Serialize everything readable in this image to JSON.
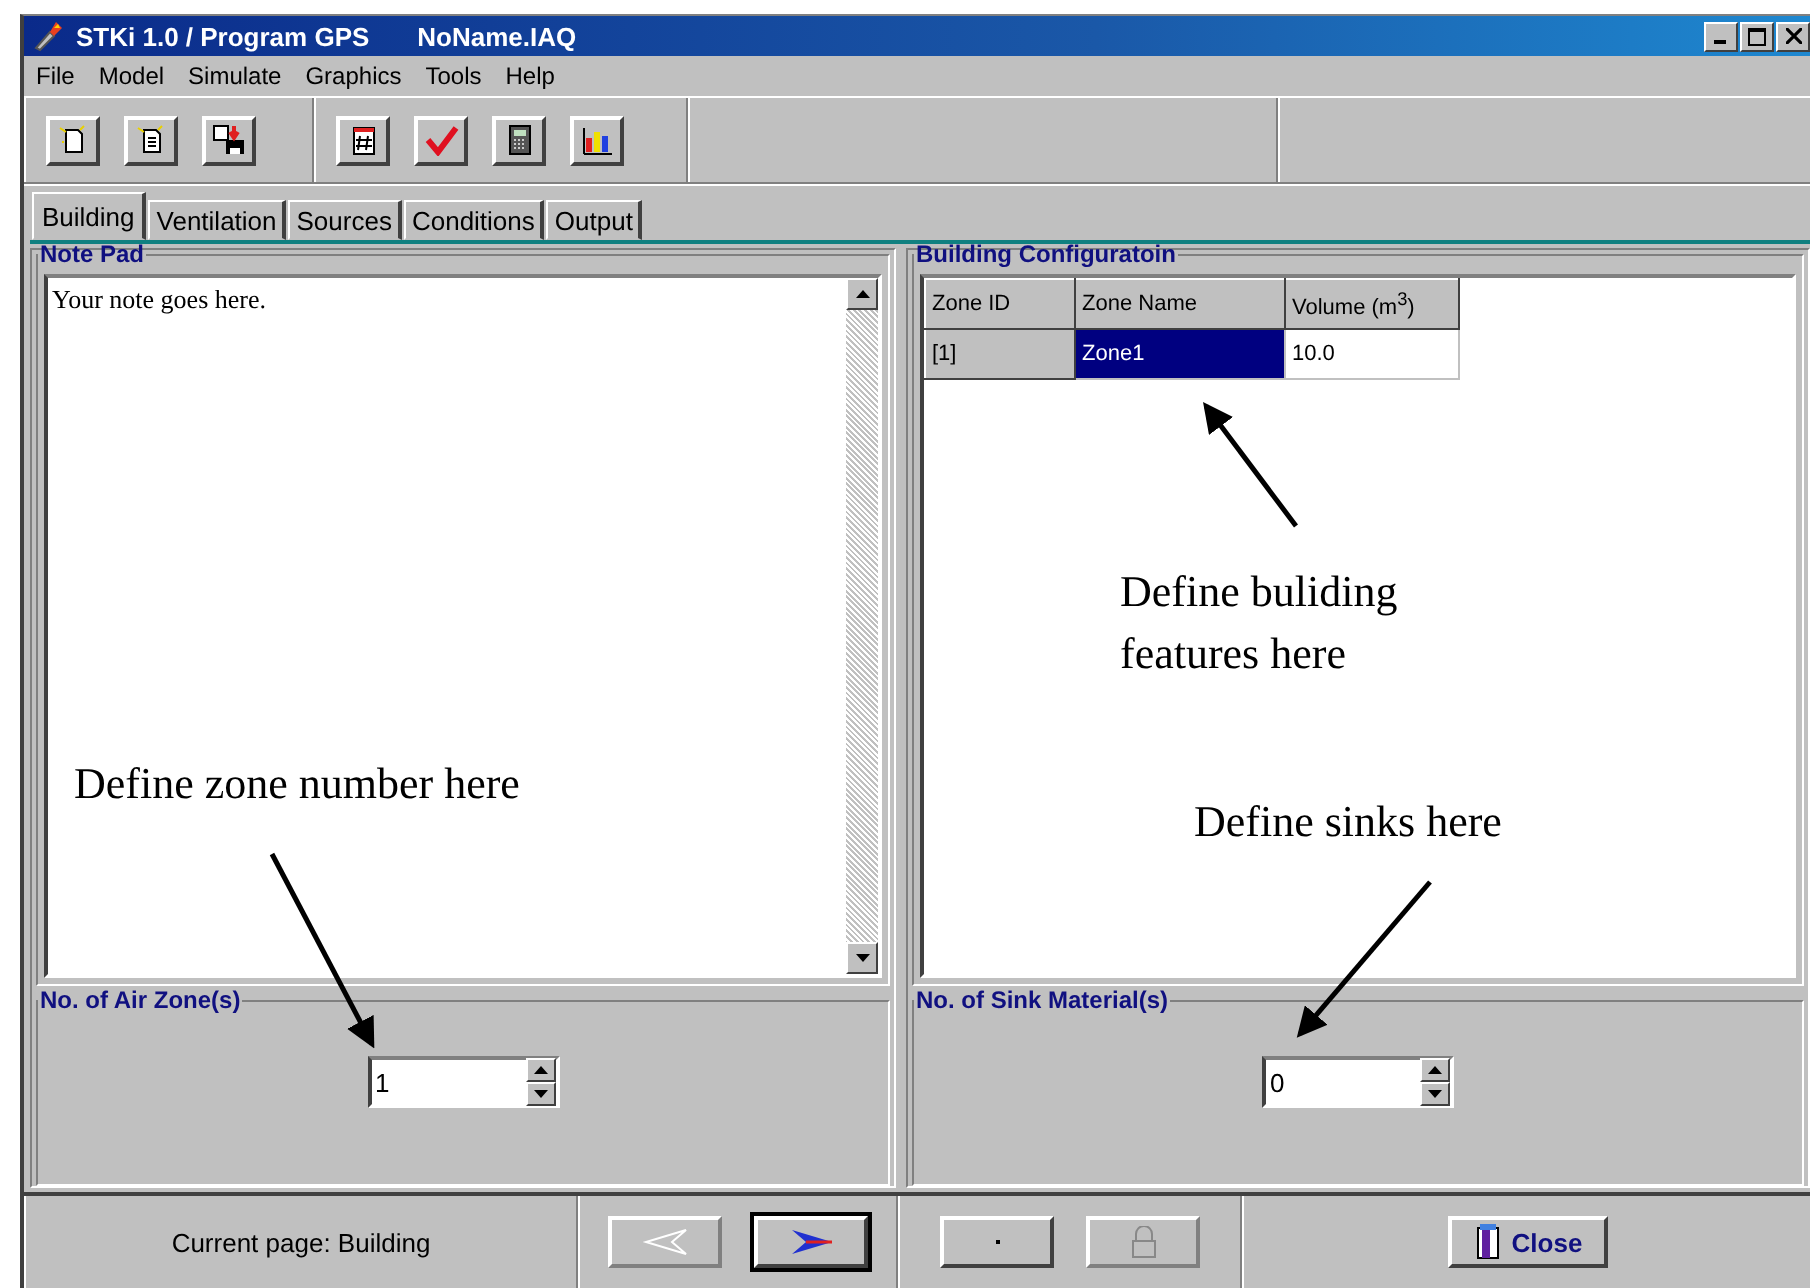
{
  "window": {
    "title": "STKi 1.0 / Program GPS",
    "file": "NoName.IAQ"
  },
  "menu": [
    {
      "label": "File"
    },
    {
      "label": "Model"
    },
    {
      "label": "Simulate"
    },
    {
      "label": "Graphics"
    },
    {
      "label": "Tools"
    },
    {
      "label": "Help"
    }
  ],
  "tabs": [
    {
      "label": "Building",
      "selected": true
    },
    {
      "label": "Ventilation",
      "selected": false
    },
    {
      "label": "Sources",
      "selected": false
    },
    {
      "label": "Conditions",
      "selected": false
    },
    {
      "label": "Output",
      "selected": false
    }
  ],
  "note_pad": {
    "title": "Note Pad",
    "text": "Your note goes here."
  },
  "building_configuration": {
    "title": "Building Configuratoin",
    "columns": [
      "Zone ID",
      "Zone Name",
      "Volume (m$^{3}$)"
    ],
    "rows": [
      {
        "cells": [
          {
            "text": "[1]",
            "selected": false
          },
          {
            "text": "Zone1",
            "selected": true
          },
          {
            "text": "10.0",
            "selected": false
          }
        ]
      }
    ]
  },
  "air_zones": {
    "title": "No. of Air Zone(s)",
    "value": "1"
  },
  "sink_materials": {
    "title": "No. of Sink Material(s)",
    "value": "0"
  },
  "annotations": [
    {
      "text": "Define buliding features here"
    },
    {
      "text": "Define zone number here"
    },
    {
      "text": "Define sinks here"
    }
  ],
  "status_bar": {
    "current_page": "Current page: Building",
    "buttons": [
      {
        "kind": "back",
        "disabled": true,
        "focused": false
      },
      {
        "kind": "forward",
        "disabled": false,
        "focused": true
      },
      {
        "kind": "blank",
        "disabled": false,
        "focused": false
      },
      {
        "kind": "lock",
        "disabled": true,
        "focused": false
      },
      {
        "kind": "close",
        "label": "Close",
        "disabled": false,
        "focused": false
      }
    ]
  }
}
